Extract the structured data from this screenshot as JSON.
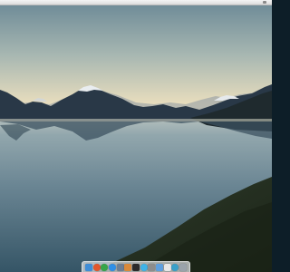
{
  "desktop": {
    "wallpaper_icon": "mountain-lake-landscape",
    "colors": {
      "sky_top": "#6f8c98",
      "sky_horizon": "#f1e3bd",
      "water": "#4f6f80",
      "top_bar": "#e8e8e8"
    }
  },
  "dock": {
    "items": [
      {
        "icon": "finder-icon",
        "color": "#3f8ed8",
        "shape": "square"
      },
      {
        "icon": "browser-icon",
        "color": "#e2572c",
        "shape": "round"
      },
      {
        "icon": "chrome-icon",
        "color": "#37a54a",
        "shape": "round"
      },
      {
        "icon": "app-store-icon",
        "color": "#2f8fe6",
        "shape": "round"
      },
      {
        "icon": "image-viewer-icon",
        "color": "#6d7f93",
        "shape": "square"
      },
      {
        "icon": "photos-icon",
        "color": "#d98a3a",
        "shape": "square"
      },
      {
        "icon": "terminal-icon",
        "color": "#2b2b2b",
        "shape": "square"
      },
      {
        "icon": "chat-icon",
        "color": "#3eb3e8",
        "shape": "round"
      },
      {
        "icon": "settings-icon",
        "color": "#8d8d8d",
        "shape": "square"
      },
      {
        "icon": "mail-icon",
        "color": "#5ea0e0",
        "shape": "square"
      },
      {
        "icon": "text-editor-icon",
        "color": "#e7e7e7",
        "shape": "square"
      },
      {
        "icon": "network-icon",
        "color": "#3aa0c8",
        "shape": "round"
      },
      {
        "icon": "trash-icon",
        "color": "#9aa3ab",
        "shape": "square"
      }
    ]
  }
}
